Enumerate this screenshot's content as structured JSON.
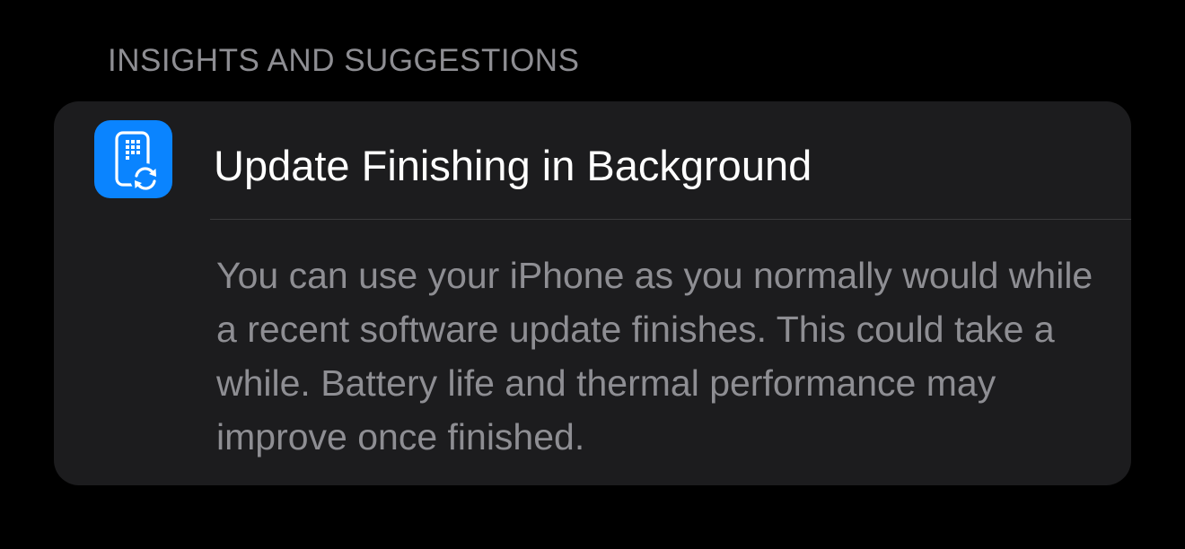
{
  "section": {
    "header": "INSIGHTS AND SUGGESTIONS"
  },
  "insight": {
    "icon": "iphone-update-icon",
    "title": "Update Finishing in Background",
    "body": "You can use your iPhone as you normally would while a recent software update finishes. This could take a while. Battery life and thermal performance may improve once finished."
  },
  "colors": {
    "background": "#000000",
    "card": "#1c1c1e",
    "accent": "#0a84ff",
    "secondary_text": "#8e8e93",
    "primary_text": "#ffffff"
  }
}
